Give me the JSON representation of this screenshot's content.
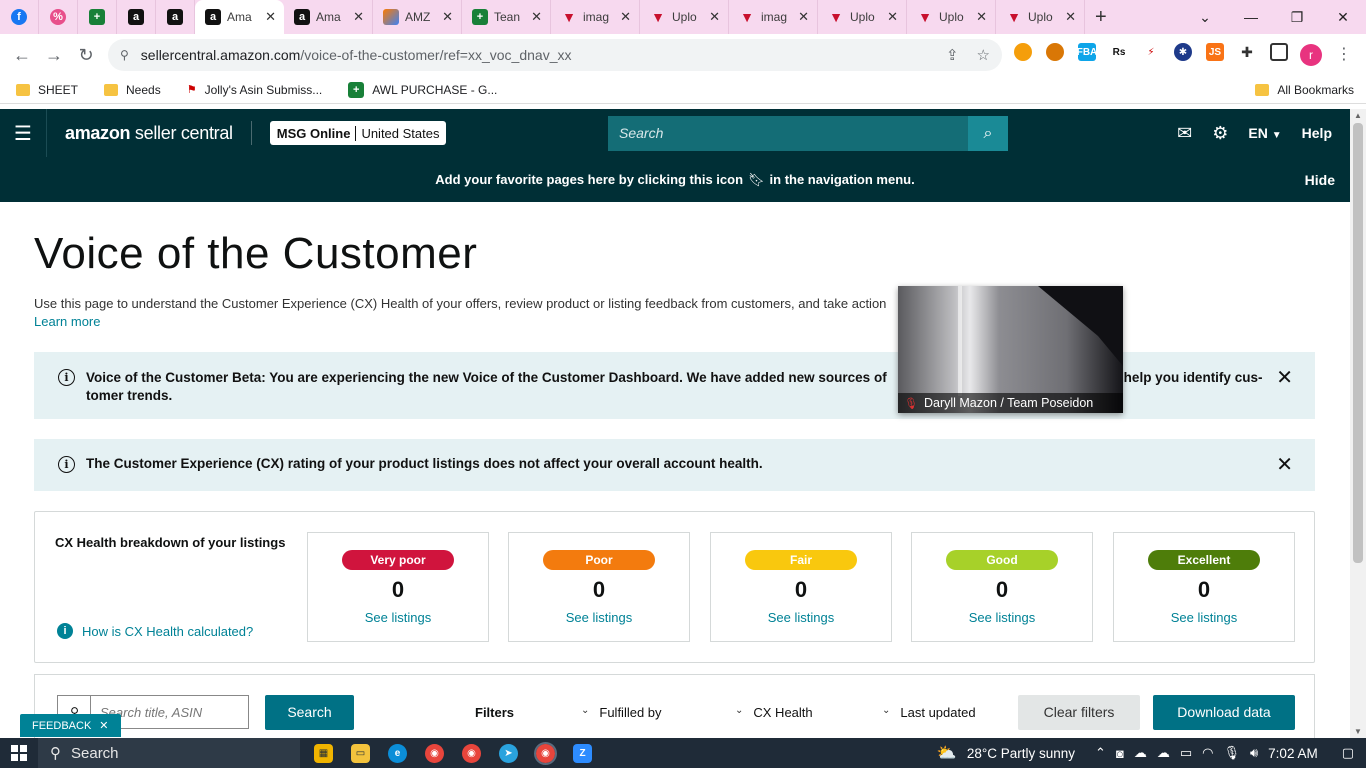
{
  "browser": {
    "tabs": [
      {
        "title": "",
        "icon": "facebook-icon"
      },
      {
        "title": "",
        "icon": "percent-icon"
      },
      {
        "title": "",
        "icon": "sheets-icon"
      },
      {
        "title": "",
        "icon": "amazon-icon"
      },
      {
        "title": "",
        "icon": "amazon-icon"
      },
      {
        "title": "Ama",
        "icon": "amazon-icon",
        "active": true
      },
      {
        "title": "Ama",
        "icon": "amazon-icon"
      },
      {
        "title": "AMZ",
        "icon": "pen-icon"
      },
      {
        "title": "Tean",
        "icon": "sheets-icon"
      },
      {
        "title": "imag",
        "icon": "upload-icon"
      },
      {
        "title": "Uplo",
        "icon": "upload-icon"
      },
      {
        "title": "imag",
        "icon": "upload-icon"
      },
      {
        "title": "Uplo",
        "icon": "upload-icon"
      },
      {
        "title": "Uplo",
        "icon": "upload-icon"
      },
      {
        "title": "Uplo",
        "icon": "upload-icon"
      }
    ],
    "url_host": "sellercentral.amazon.com",
    "url_path": "/voice-of-the-customer/ref=xx_voc_dnav_xx",
    "bookmarks": [
      "SHEET",
      "Needs",
      "Jolly's Asin Submiss...",
      "AWL PURCHASE - G..."
    ],
    "all_bookmarks": "All Bookmarks",
    "profile_initial": "r"
  },
  "header": {
    "logo_main": "amazon",
    "logo_sub": " seller central",
    "account": "MSG Online",
    "marketplace": "United States",
    "search_placeholder": "Search",
    "language": "EN",
    "help": "Help"
  },
  "favorites_bar": {
    "message_before": "Add your favorite pages here by clicking this icon",
    "message_after": "in the navigation menu.",
    "hide": "Hide"
  },
  "page": {
    "title": "Voice of the Customer",
    "intro": "Use this page to understand the Customer Experience (CX) Health of your offers, review product or listing feedback from customers, and take action",
    "learn_more": "Learn more"
  },
  "alerts": {
    "beta": "Voice of the Customer Beta: You are experiencing the new Voice of the Customer Dashboard. We have added new sources of",
    "beta_end": "o help you identify cus-",
    "beta_line2": "tomer trends.",
    "cx_rating": "The Customer Experience (CX) rating of your product listings does not affect your overall account health."
  },
  "cx_health": {
    "label": "CX Health breakdown of your listings",
    "how_link": "How is CX Health calculated?",
    "see_listings": "See listings",
    "buckets": [
      {
        "name": "Very poor",
        "count": "0",
        "color": "#d0143d",
        "text": "#ffffff"
      },
      {
        "name": "Poor",
        "count": "0",
        "color": "#f37b0e",
        "text": "#ffffff"
      },
      {
        "name": "Fair",
        "count": "0",
        "color": "#f9c80e",
        "text": "#ffffff"
      },
      {
        "name": "Good",
        "count": "0",
        "color": "#a7d129",
        "text": "#ffffff"
      },
      {
        "name": "Excellent",
        "count": "0",
        "color": "#4e7d0a",
        "text": "#ffffff"
      }
    ]
  },
  "filters": {
    "search_placeholder": "Search title, ASIN",
    "search_button": "Search",
    "filters_label": "Filters",
    "fulfilled_by": "Fulfilled by",
    "cx_health": "CX Health",
    "last_updated": "Last updated",
    "clear": "Clear filters",
    "download": "Download data"
  },
  "feedback": "FEEDBACK",
  "video": {
    "caption": "Daryll Mazon / Team Poseidon"
  },
  "taskbar": {
    "search": "Search",
    "weather": "28°C  Partly sunny",
    "time": "7:02 AM"
  }
}
